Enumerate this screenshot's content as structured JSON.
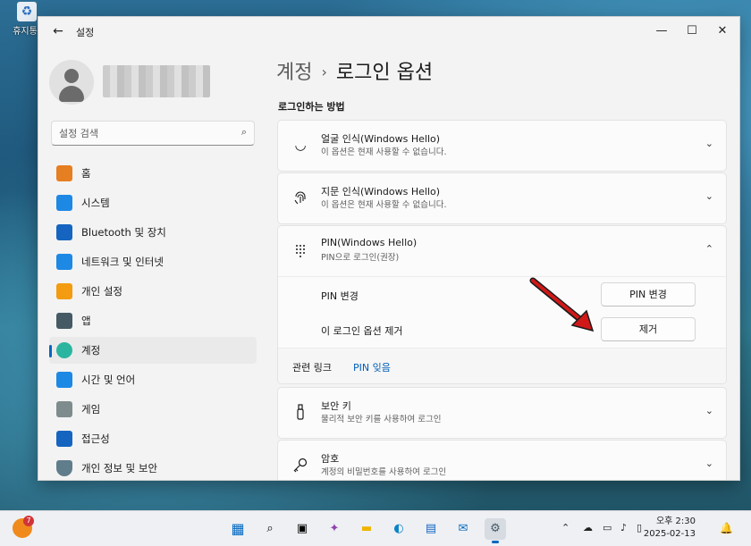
{
  "desktop": {
    "icon_label": "휴지통"
  },
  "window": {
    "title": "설정",
    "controls": {
      "minimize": "—",
      "maximize": "☐",
      "close": "✕"
    }
  },
  "sidebar": {
    "search_placeholder": "설정 검색",
    "items": [
      {
        "label": "홈",
        "icon": "home-icon",
        "color": "#e67e22"
      },
      {
        "label": "시스템",
        "icon": "system-icon",
        "color": "#1e88e5"
      },
      {
        "label": "Bluetooth 및 장치",
        "icon": "bluetooth-icon",
        "color": "#1565c0"
      },
      {
        "label": "네트워크 및 인터넷",
        "icon": "wifi-icon",
        "color": "#1e88e5"
      },
      {
        "label": "개인 설정",
        "icon": "brush-icon",
        "color": "#f39c12"
      },
      {
        "label": "앱",
        "icon": "apps-icon",
        "color": "#455a64"
      },
      {
        "label": "계정",
        "icon": "account-icon",
        "color": "#2bb5a0",
        "active": true
      },
      {
        "label": "시간 및 언어",
        "icon": "globe-clock-icon",
        "color": "#1e88e5"
      },
      {
        "label": "게임",
        "icon": "gamepad-icon",
        "color": "#7f8c8d"
      },
      {
        "label": "접근성",
        "icon": "accessibility-icon",
        "color": "#1565c0"
      },
      {
        "label": "개인 정보 및 보안",
        "icon": "shield-icon",
        "color": "#607d8b"
      }
    ]
  },
  "main": {
    "breadcrumb_parent": "계정",
    "breadcrumb_sep": "›",
    "breadcrumb_current": "로그인 옵션",
    "section_title": "로그인하는 방법",
    "options": [
      {
        "title": "얼굴 인식(Windows Hello)",
        "subtitle": "이 옵션은 현재 사용할 수 없습니다.",
        "icon": "face-icon"
      },
      {
        "title": "지문 인식(Windows Hello)",
        "subtitle": "이 옵션은 현재 사용할 수 없습니다.",
        "icon": "fingerprint-icon"
      },
      {
        "title": "PIN(Windows Hello)",
        "subtitle": "PIN으로 로그인(권장)",
        "icon": "pin-keypad-icon"
      },
      {
        "title": "보안 키",
        "subtitle": "물리적 보안 키를 사용하여 로그인",
        "icon": "usb-key-icon"
      },
      {
        "title": "암호",
        "subtitle": "계정의 비밀번호를 사용하여 로그인",
        "icon": "key-icon"
      }
    ],
    "pin": {
      "change_label": "PIN 변경",
      "change_button": "PIN 변경",
      "remove_label": "이 로그인 옵션 제거",
      "remove_button": "제거",
      "related_label": "관련 링크",
      "related_link": "PIN 잊음"
    }
  },
  "taskbar": {
    "badge_count": "7",
    "time": "오후 2:30",
    "date": "2025-02-13"
  },
  "colors": {
    "accent": "#0067c0",
    "arrow": "#d01818"
  }
}
